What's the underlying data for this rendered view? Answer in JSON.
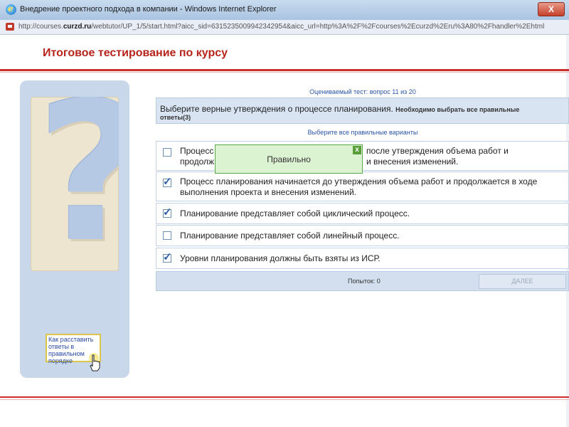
{
  "window": {
    "title": "Внедрение проектного подхода в компании - Windows Internet Explorer",
    "close_label": "X"
  },
  "address": {
    "url_prefix": "http://courses.",
    "url_domain": "curzd.ru",
    "url_rest": "/webtutor/UP_1/5/start.html?aicc_sid=6315235009942342954&aicc_url=http%3A%2F%2Fcourses%2Ecurzd%2Eru%3A80%2Fhandler%2Ehtml"
  },
  "header": {
    "title": "Итоговое тестирование по курсу"
  },
  "sidebar": {
    "help_link": "Как расставить ответы в правильном порядке"
  },
  "quiz": {
    "counter": "Оцениваемый тест: вопрос 11 из 20",
    "question": "Выберите верные утверждения о процессе планирования.",
    "hint_line1": "Необходимо выбрать все правильные",
    "hint_line2": "ответы(3)",
    "choose_all": "Выберите все правильные варианты",
    "options": [
      {
        "text_line1": "Процесс",
        "text_right1": "после утверждения объема работ и",
        "text_line2": "продолж",
        "text_right2": "и внесения изменений.",
        "checked": false
      },
      {
        "text": "Процесс планирования начинается до утверждения объема работ и продолжается в ходе выполнения проекта и внесения изменений.",
        "checked": true
      },
      {
        "text": "Планирование представляет собой циклический процесс.",
        "checked": true
      },
      {
        "text": "Планирование представляет собой линейный процесс.",
        "checked": false
      },
      {
        "text": "Уровни планирования должны быть взяты из ИСР.",
        "checked": true
      }
    ],
    "attempts": "Попыток: 0",
    "next_button": "ДАЛЕЕ"
  },
  "popup": {
    "message": "Правильно",
    "close_label": "x"
  },
  "colors": {
    "accent_red": "#b7241b",
    "link_blue": "#2a54a6",
    "popup_green": "#dcf3d2"
  },
  "icons": {
    "browser": "ie-logo-icon",
    "page": "page-favicon-icon",
    "question_mark": "question-mark-icon",
    "cursor": "hand-pointer-icon",
    "checkmark": "checkmark-icon"
  }
}
